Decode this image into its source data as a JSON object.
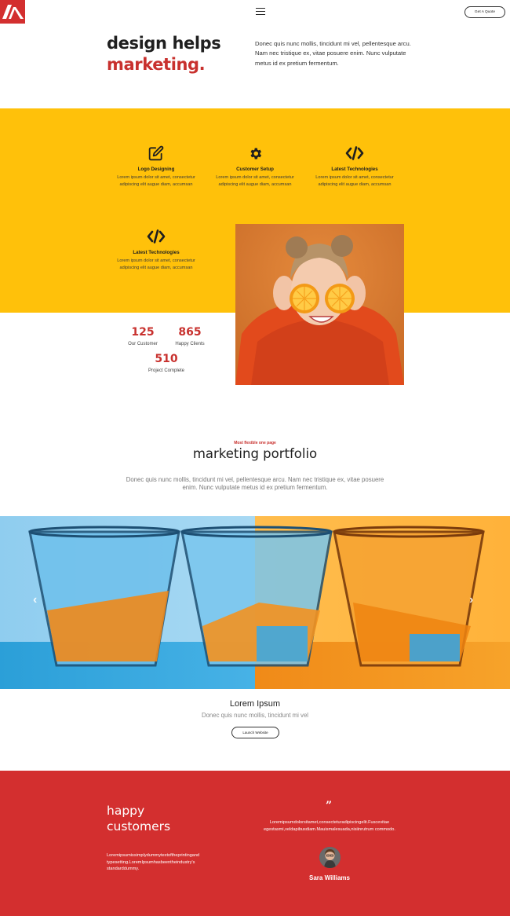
{
  "header": {
    "quote_button": "Get A Quote"
  },
  "hero": {
    "title_line1": "design helps",
    "title_line2": "marketing.",
    "description": "Donec quis nunc mollis, tincidunt mi vel, pellentesque arcu. Nam nec tristique ex, vitae posuere enim. Nunc vulputate metus id ex pretium fermentum."
  },
  "features": [
    {
      "icon": "edit-icon",
      "title": "Logo Designing",
      "desc": "Lorem ipsum dolor sit amet, consectetur adipiscing elit augue diam, accumsan"
    },
    {
      "icon": "gear-icon",
      "title": "Customer Setup",
      "desc": "Lorem ipsum dolor sit amet, consectetur adipiscing elit augue diam, accumsan"
    },
    {
      "icon": "code-icon",
      "title": "Latest Technologies",
      "desc": "Lorem ipsum dolor sit amet, consectetur adipiscing elit augue diam, accumsan"
    },
    {
      "icon": "code-icon",
      "title": "Latest Technologies",
      "desc": "Lorem ipsum dolor sit amet, consectetur adipiscing elit augue diam, accumsan"
    }
  ],
  "stats": [
    {
      "value": "125",
      "label": "Our Customer"
    },
    {
      "value": "865",
      "label": "Happy Clients"
    },
    {
      "value": "510",
      "label": "Project Complete"
    }
  ],
  "portfolio": {
    "kicker": "Most flexible one page",
    "title": "marketing portfolio",
    "description": "Donec quis nunc mollis, tincidunt mi vel, pellentesque arcu. Nam nec tristique ex, vitae posuere enim. Nunc vulputate metus id ex pretium fermentum."
  },
  "slider": {
    "prev": "‹",
    "next": "›",
    "title": "Lorem Ipsum",
    "subtitle": "Donec quis nunc mollis, tincidunt mi vel",
    "button": "Launch Website"
  },
  "testimonials": {
    "title_line1": "happy",
    "title_line2": "customers",
    "intro": "Loremipsumissimplydummytextoftheprintingand typesetting.LoremIpsumhasbeentheindustry's standarddummy.",
    "quote_mark": "”",
    "quote": "Loremipsumdolorsitamet,consecteturadipiscingelit.Fuscevitae egestasmi,veldapibusdiam.Mauismalesuada,nisiinrutrum commodo.",
    "author": "Sara Williams"
  },
  "colors": {
    "brand_red": "#d32f2f",
    "accent_yellow": "#ffc10a",
    "heading_red": "#c8312e"
  }
}
